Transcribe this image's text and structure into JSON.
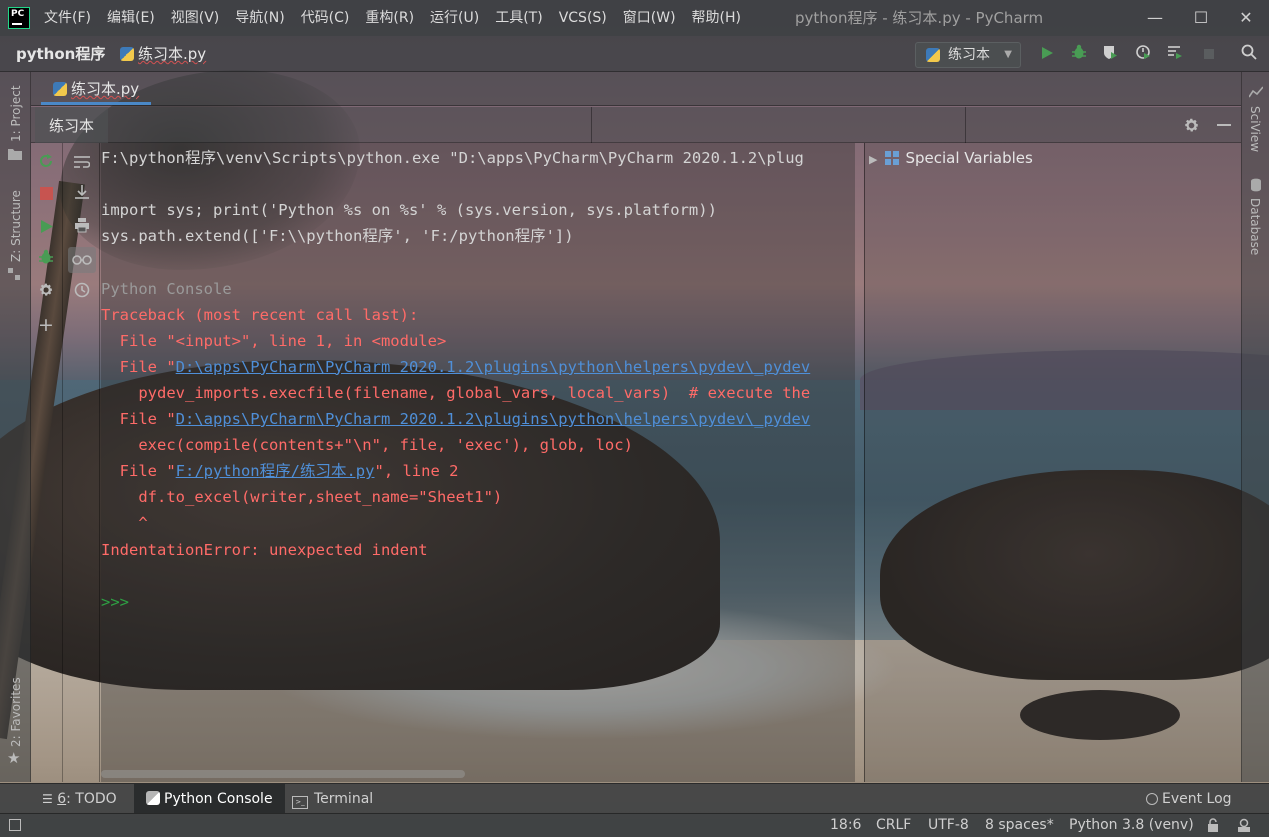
{
  "app": {
    "window_title": "python程序 - 练习本.py - PyCharm",
    "logo_text": "PC"
  },
  "menu": [
    "文件(F)",
    "编辑(E)",
    "视图(V)",
    "导航(N)",
    "代码(C)",
    "重构(R)",
    "运行(U)",
    "工具(T)",
    "VCS(S)",
    "窗口(W)",
    "帮助(H)"
  ],
  "window_controls": {
    "minimize": "—",
    "maximize": "☐",
    "close": "✕"
  },
  "navbar": {
    "project": "python程序",
    "file": "练习本.py",
    "run_config": "练习本"
  },
  "left_stripe": {
    "project": "1: Project",
    "structure": "Z: Structure",
    "favorites": "2: Favorites"
  },
  "right_stripe": {
    "sciview": "SciView",
    "database": "Database"
  },
  "editor_tab": "练习本.py",
  "console_tab": "练习本",
  "console_lines": [
    {
      "text": "F:\\python程序\\venv\\Scripts\\python.exe \"D:\\apps\\PyCharm\\PyCharm 2020.1.2\\plug",
      "style": "norm"
    },
    {
      "text": "",
      "style": "norm"
    },
    {
      "text": "import sys; print('Python %s on %s' % (sys.version, sys.platform))",
      "style": "norm"
    },
    {
      "text": "sys.path.extend(['F:\\\\python程序', 'F:/python程序'])",
      "style": "norm"
    },
    {
      "text": "",
      "style": "norm"
    },
    {
      "text": "Python Console",
      "style": "gray"
    },
    {
      "text": "Traceback (most recent call last):",
      "style": "err"
    },
    {
      "text": "  File \"<input>\", line 1, in <module>",
      "style": "err"
    },
    {
      "prefix": "  File \"",
      "link": "D:\\apps\\PyCharm\\PyCharm 2020.1.2\\plugins\\python\\helpers\\pydev\\_pydev",
      "style": "err"
    },
    {
      "text": "    pydev_imports.execfile(filename, global_vars, local_vars)  # execute the",
      "style": "err"
    },
    {
      "prefix": "  File \"",
      "link": "D:\\apps\\PyCharm\\PyCharm 2020.1.2\\plugins\\python\\helpers\\pydev\\_pydev",
      "style": "err"
    },
    {
      "text": "    exec(compile(contents+\"\\n\", file, 'exec'), glob, loc)",
      "style": "err"
    },
    {
      "prefix": "  File \"",
      "link": "F:/python程序/练习本.py",
      "suffix": "\", line 2",
      "style": "err"
    },
    {
      "text": "    df.to_excel(writer,sheet_name=\"Sheet1\")",
      "style": "err"
    },
    {
      "text": "    ^",
      "style": "err"
    },
    {
      "text": "IndentationError: unexpected indent",
      "style": "err"
    },
    {
      "text": "",
      "style": "norm"
    },
    {
      "text": ">>>",
      "style": "prompt"
    }
  ],
  "variables_panel": {
    "root_label": "Special Variables"
  },
  "bottom_tools": {
    "todo_number": "6",
    "todo_label": ": TODO",
    "python_console": "Python Console",
    "terminal": "Terminal",
    "event_log": "Event Log"
  },
  "status_bar": {
    "position": "18:6",
    "line_separator": "CRLF",
    "encoding": "UTF-8",
    "indent": "8 spaces*",
    "interpreter": "Python 3.8 (venv)"
  },
  "colors": {
    "run_green": "#499c54",
    "stop_red": "#c75450",
    "error_red": "#ff6b68",
    "link_blue": "#4f8fd8",
    "tab_underline": "#4a88c7"
  }
}
